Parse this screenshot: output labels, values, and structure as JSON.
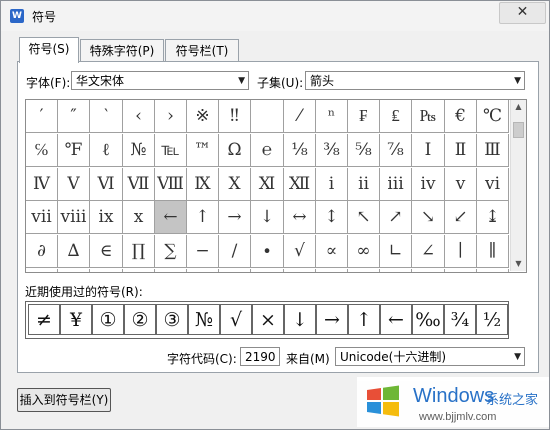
{
  "window": {
    "title": "符号",
    "app_icon_letter": "W",
    "close_glyph": "✕"
  },
  "tabs": [
    "符号(S)",
    "特殊字符(P)",
    "符号栏(T)"
  ],
  "font": {
    "label": "字体(F):",
    "value": "华文宋体"
  },
  "subset": {
    "label": "子集(U):",
    "value": "箭头"
  },
  "symbol_grid": [
    [
      "′",
      "″",
      "‵",
      "‹",
      "›",
      "※",
      "‼",
      "",
      "⁄",
      "ⁿ",
      "₣",
      "₤",
      "₧",
      "€",
      "℃"
    ],
    [
      "℅",
      "℉",
      "ℓ",
      "№",
      "℡",
      "™",
      "Ω",
      "℮",
      "⅛",
      "⅜",
      "⅝",
      "⅞",
      "Ⅰ",
      "Ⅱ",
      "Ⅲ"
    ],
    [
      "Ⅳ",
      "Ⅴ",
      "Ⅵ",
      "Ⅶ",
      "Ⅷ",
      "Ⅸ",
      "Ⅹ",
      "Ⅺ",
      "Ⅻ",
      "ⅰ",
      "ⅱ",
      "ⅲ",
      "ⅳ",
      "ⅴ",
      "ⅵ"
    ],
    [
      "ⅶ",
      "ⅷ",
      "ⅸ",
      "ⅹ",
      "←",
      "↑",
      "→",
      "↓",
      "↔",
      "↕",
      "↖",
      "↗",
      "↘",
      "↙",
      "↨"
    ],
    [
      "∂",
      "∆",
      "∈",
      "∏",
      "∑",
      "−",
      "∕",
      "∙",
      "√",
      "∝",
      "∞",
      "∟",
      "∠",
      "∣",
      "∥"
    ],
    [
      "",
      "",
      "",
      "",
      "",
      "",
      "",
      "",
      "",
      "",
      "",
      "",
      "",
      "",
      ""
    ]
  ],
  "selected_symbol": "←",
  "recent": {
    "label": "近期使用过的符号(R):",
    "symbols": [
      "≠",
      "¥",
      "①",
      "②",
      "③",
      "№",
      "√",
      "×",
      "↓",
      "→",
      "↑",
      "←",
      "‰",
      "¾",
      "½"
    ]
  },
  "char_code": {
    "label": "字符代码(C):",
    "value": "2190"
  },
  "from": {
    "label": "来自(M)",
    "value": "Unicode(十六进制)"
  },
  "insert_button": "插入到符号栏(Y)",
  "watermark": {
    "windows": "Windows",
    "cn": "系统之家",
    "url": "www.bjjmlv.com"
  },
  "colors": {
    "accent": "#2b67c8",
    "selected_cell": "#c4c4c4",
    "watermark_blue": "#1c6ac5"
  }
}
